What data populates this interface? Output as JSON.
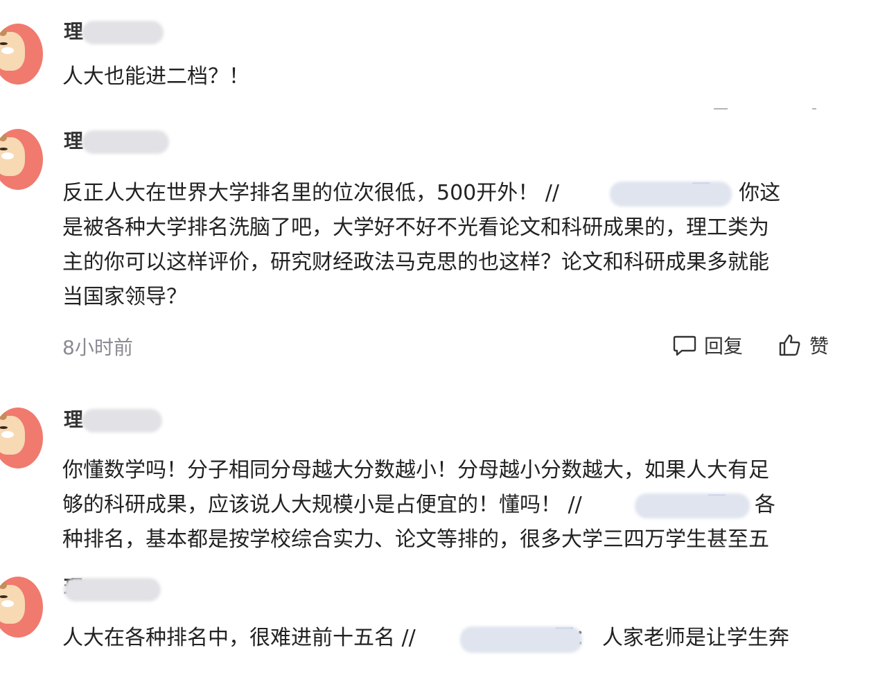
{
  "comments": [
    {
      "user_prefix": "理",
      "lines": [
        "人大也能进二档？！"
      ]
    },
    {
      "user_prefix": "理",
      "line1_a": "反正人大在世界大学排名里的位次很低，500开外！ //",
      "line1_b": "圈",
      "line1_c": "：   你这",
      "line2": "是被各种大学排名洗脑了吧，大学好不好不光看论文和科研成果的，理工类为",
      "line3": "主的你可以这样评价，研究财经政法马克思的也这样？论文和科研成果多就能",
      "line4": "当国家领导？",
      "time": "8小时前",
      "reply_label": "回复",
      "like_label": "赞"
    },
    {
      "user_prefix": "理",
      "line1": "你懂数学吗！分子相同分母越大分数越小！分母越小分数越大，如果人大有足",
      "line2_a": "够的科研成果，应该说人大规模小是占便宜的！懂吗！ //",
      "line2_b": "圈",
      "line2_c": "：   各",
      "line3": "种排名，基本都是按学校综合实力、论文等排的，很多大学三四万学生甚至五"
    },
    {
      "user_prefix": "理",
      "line1_a": "人大在各种排名中，很难进前十五名 //",
      "line1_b": "圈",
      "line1_c": "：   人家老师是让学生奔"
    }
  ],
  "colors": {
    "avatar_bg": "#f07a6e",
    "mention_blue": "#3b6fd1",
    "time_gray": "#8a8a92"
  },
  "icons": {
    "reply": "speech-bubble-icon",
    "like": "thumbs-up-icon"
  }
}
